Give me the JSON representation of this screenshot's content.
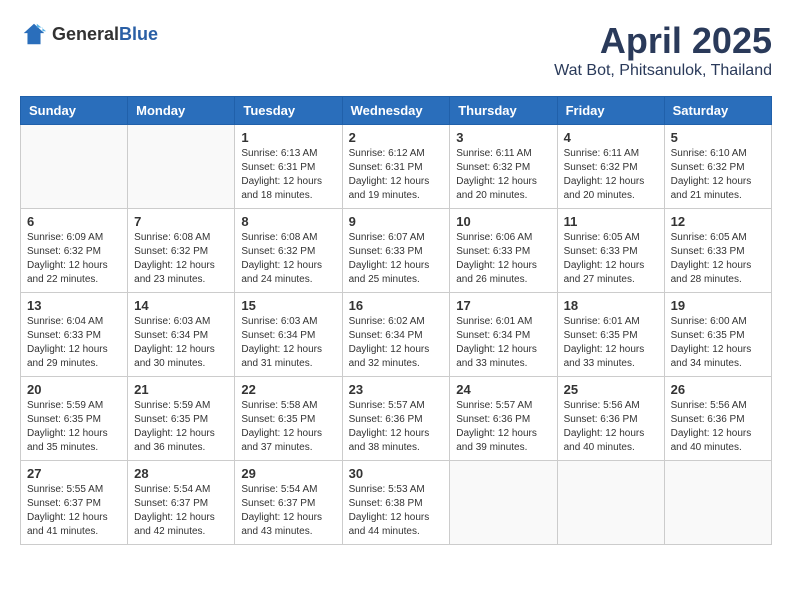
{
  "header": {
    "logo_general": "General",
    "logo_blue": "Blue",
    "month": "April 2025",
    "location": "Wat Bot, Phitsanulok, Thailand"
  },
  "weekdays": [
    "Sunday",
    "Monday",
    "Tuesday",
    "Wednesday",
    "Thursday",
    "Friday",
    "Saturday"
  ],
  "weeks": [
    [
      {
        "day": "",
        "info": ""
      },
      {
        "day": "",
        "info": ""
      },
      {
        "day": "1",
        "info": "Sunrise: 6:13 AM\nSunset: 6:31 PM\nDaylight: 12 hours and 18 minutes."
      },
      {
        "day": "2",
        "info": "Sunrise: 6:12 AM\nSunset: 6:31 PM\nDaylight: 12 hours and 19 minutes."
      },
      {
        "day": "3",
        "info": "Sunrise: 6:11 AM\nSunset: 6:32 PM\nDaylight: 12 hours and 20 minutes."
      },
      {
        "day": "4",
        "info": "Sunrise: 6:11 AM\nSunset: 6:32 PM\nDaylight: 12 hours and 20 minutes."
      },
      {
        "day": "5",
        "info": "Sunrise: 6:10 AM\nSunset: 6:32 PM\nDaylight: 12 hours and 21 minutes."
      }
    ],
    [
      {
        "day": "6",
        "info": "Sunrise: 6:09 AM\nSunset: 6:32 PM\nDaylight: 12 hours and 22 minutes."
      },
      {
        "day": "7",
        "info": "Sunrise: 6:08 AM\nSunset: 6:32 PM\nDaylight: 12 hours and 23 minutes."
      },
      {
        "day": "8",
        "info": "Sunrise: 6:08 AM\nSunset: 6:32 PM\nDaylight: 12 hours and 24 minutes."
      },
      {
        "day": "9",
        "info": "Sunrise: 6:07 AM\nSunset: 6:33 PM\nDaylight: 12 hours and 25 minutes."
      },
      {
        "day": "10",
        "info": "Sunrise: 6:06 AM\nSunset: 6:33 PM\nDaylight: 12 hours and 26 minutes."
      },
      {
        "day": "11",
        "info": "Sunrise: 6:05 AM\nSunset: 6:33 PM\nDaylight: 12 hours and 27 minutes."
      },
      {
        "day": "12",
        "info": "Sunrise: 6:05 AM\nSunset: 6:33 PM\nDaylight: 12 hours and 28 minutes."
      }
    ],
    [
      {
        "day": "13",
        "info": "Sunrise: 6:04 AM\nSunset: 6:33 PM\nDaylight: 12 hours and 29 minutes."
      },
      {
        "day": "14",
        "info": "Sunrise: 6:03 AM\nSunset: 6:34 PM\nDaylight: 12 hours and 30 minutes."
      },
      {
        "day": "15",
        "info": "Sunrise: 6:03 AM\nSunset: 6:34 PM\nDaylight: 12 hours and 31 minutes."
      },
      {
        "day": "16",
        "info": "Sunrise: 6:02 AM\nSunset: 6:34 PM\nDaylight: 12 hours and 32 minutes."
      },
      {
        "day": "17",
        "info": "Sunrise: 6:01 AM\nSunset: 6:34 PM\nDaylight: 12 hours and 33 minutes."
      },
      {
        "day": "18",
        "info": "Sunrise: 6:01 AM\nSunset: 6:35 PM\nDaylight: 12 hours and 33 minutes."
      },
      {
        "day": "19",
        "info": "Sunrise: 6:00 AM\nSunset: 6:35 PM\nDaylight: 12 hours and 34 minutes."
      }
    ],
    [
      {
        "day": "20",
        "info": "Sunrise: 5:59 AM\nSunset: 6:35 PM\nDaylight: 12 hours and 35 minutes."
      },
      {
        "day": "21",
        "info": "Sunrise: 5:59 AM\nSunset: 6:35 PM\nDaylight: 12 hours and 36 minutes."
      },
      {
        "day": "22",
        "info": "Sunrise: 5:58 AM\nSunset: 6:35 PM\nDaylight: 12 hours and 37 minutes."
      },
      {
        "day": "23",
        "info": "Sunrise: 5:57 AM\nSunset: 6:36 PM\nDaylight: 12 hours and 38 minutes."
      },
      {
        "day": "24",
        "info": "Sunrise: 5:57 AM\nSunset: 6:36 PM\nDaylight: 12 hours and 39 minutes."
      },
      {
        "day": "25",
        "info": "Sunrise: 5:56 AM\nSunset: 6:36 PM\nDaylight: 12 hours and 40 minutes."
      },
      {
        "day": "26",
        "info": "Sunrise: 5:56 AM\nSunset: 6:36 PM\nDaylight: 12 hours and 40 minutes."
      }
    ],
    [
      {
        "day": "27",
        "info": "Sunrise: 5:55 AM\nSunset: 6:37 PM\nDaylight: 12 hours and 41 minutes."
      },
      {
        "day": "28",
        "info": "Sunrise: 5:54 AM\nSunset: 6:37 PM\nDaylight: 12 hours and 42 minutes."
      },
      {
        "day": "29",
        "info": "Sunrise: 5:54 AM\nSunset: 6:37 PM\nDaylight: 12 hours and 43 minutes."
      },
      {
        "day": "30",
        "info": "Sunrise: 5:53 AM\nSunset: 6:38 PM\nDaylight: 12 hours and 44 minutes."
      },
      {
        "day": "",
        "info": ""
      },
      {
        "day": "",
        "info": ""
      },
      {
        "day": "",
        "info": ""
      }
    ]
  ]
}
